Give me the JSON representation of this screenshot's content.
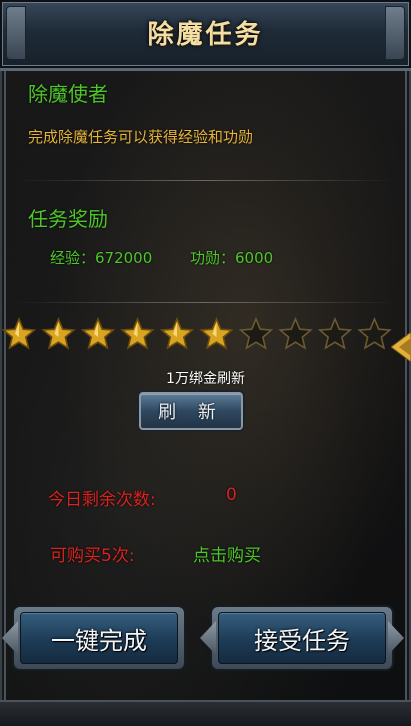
{
  "header": {
    "title": "除魔任务"
  },
  "role": {
    "name": "除魔使者",
    "description": "完成除魔任务可以获得经验和功勋"
  },
  "rewards": {
    "label": "任务奖励",
    "exp_label": "经验：672000",
    "merit_label": "功勋：6000"
  },
  "stars": {
    "filled": 6,
    "total": 10,
    "filled_color": "#d9a421",
    "empty_color": "#6b5a30"
  },
  "refresh": {
    "cost_text": "1万绑金刷新",
    "button_label": "刷 新"
  },
  "daily": {
    "remaining_label": "今日剩余次数:",
    "remaining_value": "0"
  },
  "purchase": {
    "label": "可购买5次:",
    "link": "点击购买"
  },
  "actions": {
    "complete_all": "一键完成",
    "accept": "接受任务"
  },
  "colors": {
    "green": "#4ec62a",
    "gold": "#e7b43a",
    "red": "#d8231f",
    "title": "#f3dfa6"
  }
}
